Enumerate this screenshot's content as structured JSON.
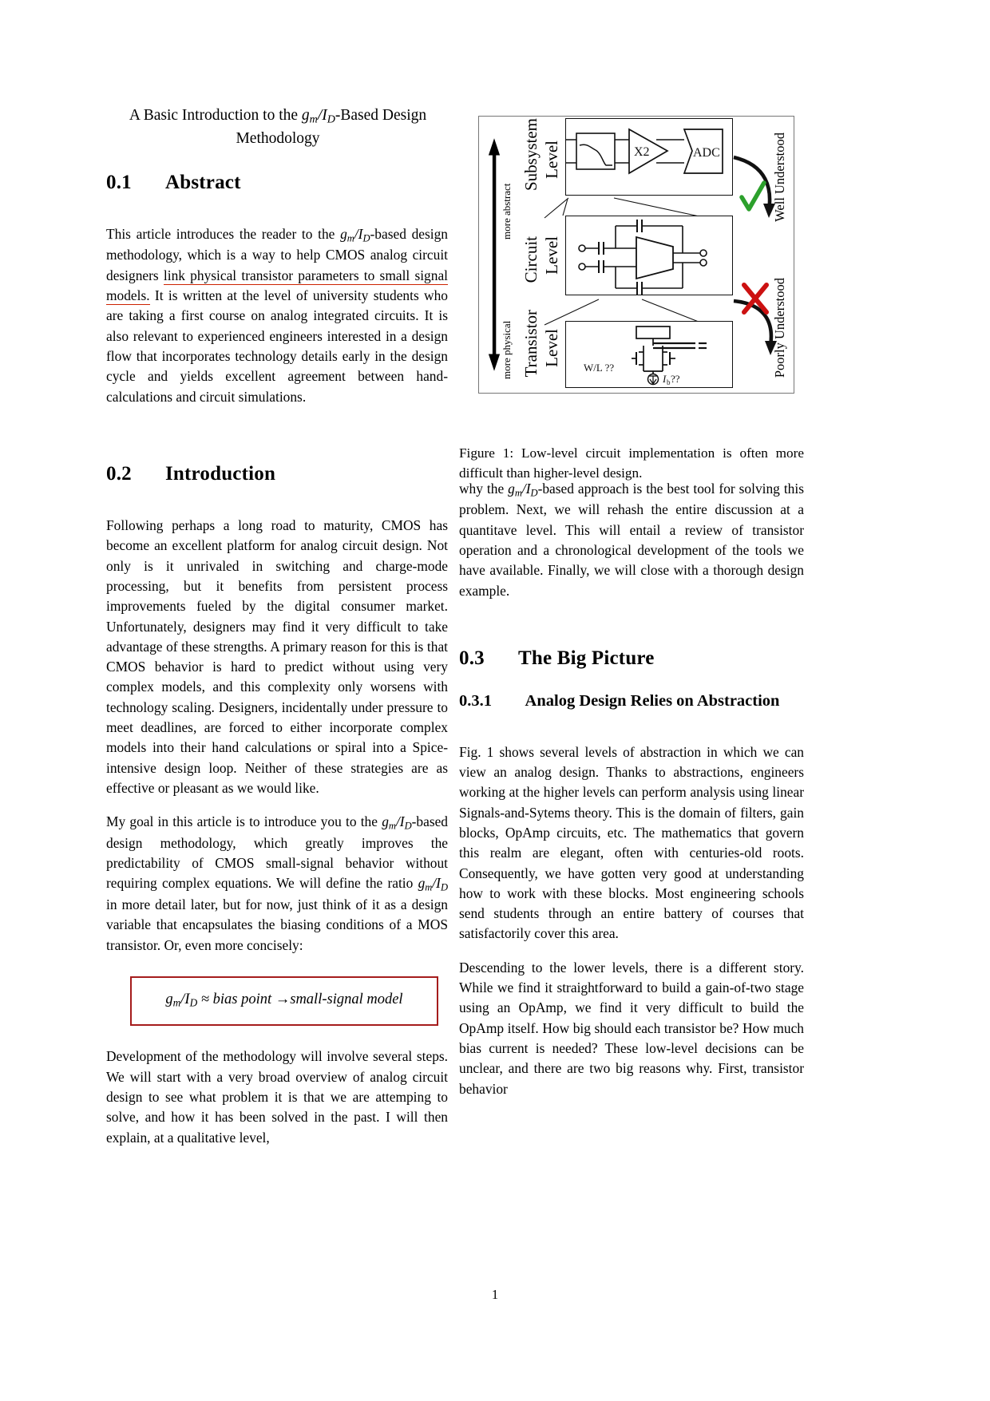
{
  "document": {
    "title_line1": "A Basic Introduction to the ",
    "title_math": "gm/ID",
    "title_line1b": "-Based Design",
    "title_line2": "Methodology",
    "page_number": "1"
  },
  "sections": {
    "abstract": {
      "number": "0.1",
      "heading": "Abstract",
      "p1_a": "This article introduces the reader to the ",
      "p1_b": "-based design methodology, which is a way to help CMOS analog circuit designers ",
      "p1_underlined": "link physical transistor parameters to small signal models.",
      "p1_c": " It is written at the level of university students who are taking a first course on analog integrated circuits. It is also relevant to experienced engineers interested in a design flow that incorporates technology details early in the design cycle and yields excellent agreement between hand-calculations and circuit simulations."
    },
    "introduction": {
      "number": "0.2",
      "heading": "Introduction",
      "p1": "Following perhaps a long road to maturity, CMOS has become an excellent platform for analog circuit design. Not only is it unrivaled in switching and charge-mode processing, but it benefits from persistent process improvements fueled by the digital consumer market. Unfortunately, designers may find it very difficult to take advantage of these strengths. A primary reason for this is that CMOS behavior is hard to predict without using very complex models, and this complexity only worsens with technology scaling. Designers, incidentally under pressure to meet deadlines, are forced to either incorporate complex models into their hand calculations or spiral into a Spice-intensive design loop. Neither of these strategies are as effective or pleasant as we would like.",
      "p2_a": "My goal in this article is to introduce you to the ",
      "p2_b": "-based design methodology, which greatly improves the predictability of CMOS small-signal behavior without requiring complex equations. We will define the ratio ",
      "p2_c": " in more detail later, but for now, just think of it as a design variable that encapsulates the biasing conditions of a MOS transistor. Or, even more concisely:",
      "equation": "gm/ID ≈ bias point →small-signal model",
      "equation_parts": {
        "lhs": "g",
        "lhs_sub": "m",
        "slash": "/I",
        "lhs_sub2": "D",
        "approx": " ≈ bias point ",
        "arrow": "→",
        "rhs": "small-signal model"
      },
      "p3": "Development of the methodology will involve several steps. We will start with a very broad overview of analog circuit design to see what problem it is that we are attemping to solve, and how it has been solved in the past. I will then explain, at a qualitative level,",
      "p4_a": "why the ",
      "p4_b": "-based approach is the best tool for solving this problem. Next, we will rehash the entire discussion at a quantitave level. This will entail a review of transistor operation and a chronological development of the tools we have available. Finally, we will close with a thorough design example."
    },
    "big_picture": {
      "number": "0.3",
      "heading": "The Big Picture",
      "sub_number": "0.3.1",
      "sub_heading": "Analog Design Relies on Abstraction",
      "p1": "Fig. 1 shows several levels of abstraction in which we can view an analog design. Thanks to abstractions, engineers working at the higher levels can perform analysis using linear Signals-and-Sytems theory. This is the domain of filters, gain blocks, OpAmp circuits, etc. The mathematics that govern this realm are elegant, often with centuries-old roots. Consequently, we have gotten very good at understanding how to work with these blocks. Most engineering schools send students through an entire battery of courses that satisfactorily cover this area.",
      "p2": "Descending to the lower levels, there is a different story. While we find it straightforward to build a gain-of-two stage using an OpAmp, we find it very difficult to build the OpAmp itself. How big should each transistor be? How much bias current is needed? These low-level decisions can be unclear, and there are two big reasons why. First, transistor behavior"
    }
  },
  "figure": {
    "caption_label": "Figure 1:",
    "caption_text": "  Low-level circuit implementation is often more difficult than higher-level design.",
    "axis_top_label": "more abstract",
    "axis_bottom_label": "more physical",
    "levels": [
      {
        "name_line1": "Subsystem",
        "name_line2": "Level"
      },
      {
        "name_line1": "Circuit",
        "name_line2": "Level"
      },
      {
        "name_line1": "Transistor",
        "name_line2": "Level"
      }
    ],
    "right_labels": [
      {
        "text": "Well Understood",
        "mark": "check",
        "color": "#2ca02c"
      },
      {
        "text": "Poorly Understood",
        "mark": "cross",
        "color": "#cc1111"
      }
    ],
    "subsystem_blocks": {
      "filter": "filter-response",
      "amp_label": "X2",
      "adc_label": "ADC"
    },
    "transistor_labels": {
      "wl": "W/L ??",
      "ib_main": "I",
      "ib_sub": "b",
      "ib_q": " ??"
    }
  },
  "colors": {
    "red_underline": "#cc2200",
    "box_red": "#a51c1c",
    "check_green": "#2ca02c",
    "cross_red": "#cc1111",
    "text": "#000000",
    "figure_border": "#777777"
  }
}
